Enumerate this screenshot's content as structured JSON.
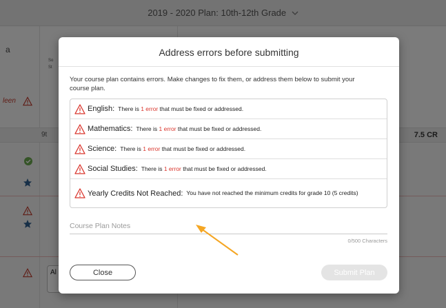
{
  "background": {
    "plan_title": "2019 - 2020 Plan: 10th-12th Grade",
    "left_letter": "a",
    "left_red_text": "leen",
    "col_small_1": "So",
    "col_small_2": "St",
    "row_label": "9t",
    "row_credits": "7.5 CR",
    "lower_label": "Al"
  },
  "modal": {
    "title": "Address errors before submitting",
    "intro": "Your course plan contains errors. Make changes to fix them, or address them below to submit your course plan.",
    "errors": [
      {
        "subject": "English:",
        "pre": "There is ",
        "count": "1 error",
        "post": " that must be fixed or addressed."
      },
      {
        "subject": "Mathematics:",
        "pre": "There is ",
        "count": "1 error",
        "post": " that must be fixed or addressed."
      },
      {
        "subject": "Science:",
        "pre": "There is ",
        "count": "1 error",
        "post": " that must be fixed or addressed."
      },
      {
        "subject": "Social Studies:",
        "pre": "There is ",
        "count": "1 error",
        "post": " that must be fixed or addressed."
      },
      {
        "subject": "Yearly Credits Not Reached:",
        "message": "You have not reached the minimum credits for grade 10 (5 credits)"
      }
    ],
    "notes_placeholder": "Course Plan Notes",
    "notes_value": "",
    "char_counter": "0/500 Characters",
    "close_label": "Close",
    "submit_label": "Submit Plan"
  },
  "colors": {
    "error_red": "#d9342b",
    "annotation_arrow": "#f5a623",
    "success_green": "#6aa84f",
    "star_blue": "#2f5f8f"
  },
  "icons": [
    "chevron-down-icon",
    "warning-icon",
    "check-circle-icon",
    "star-icon"
  ]
}
